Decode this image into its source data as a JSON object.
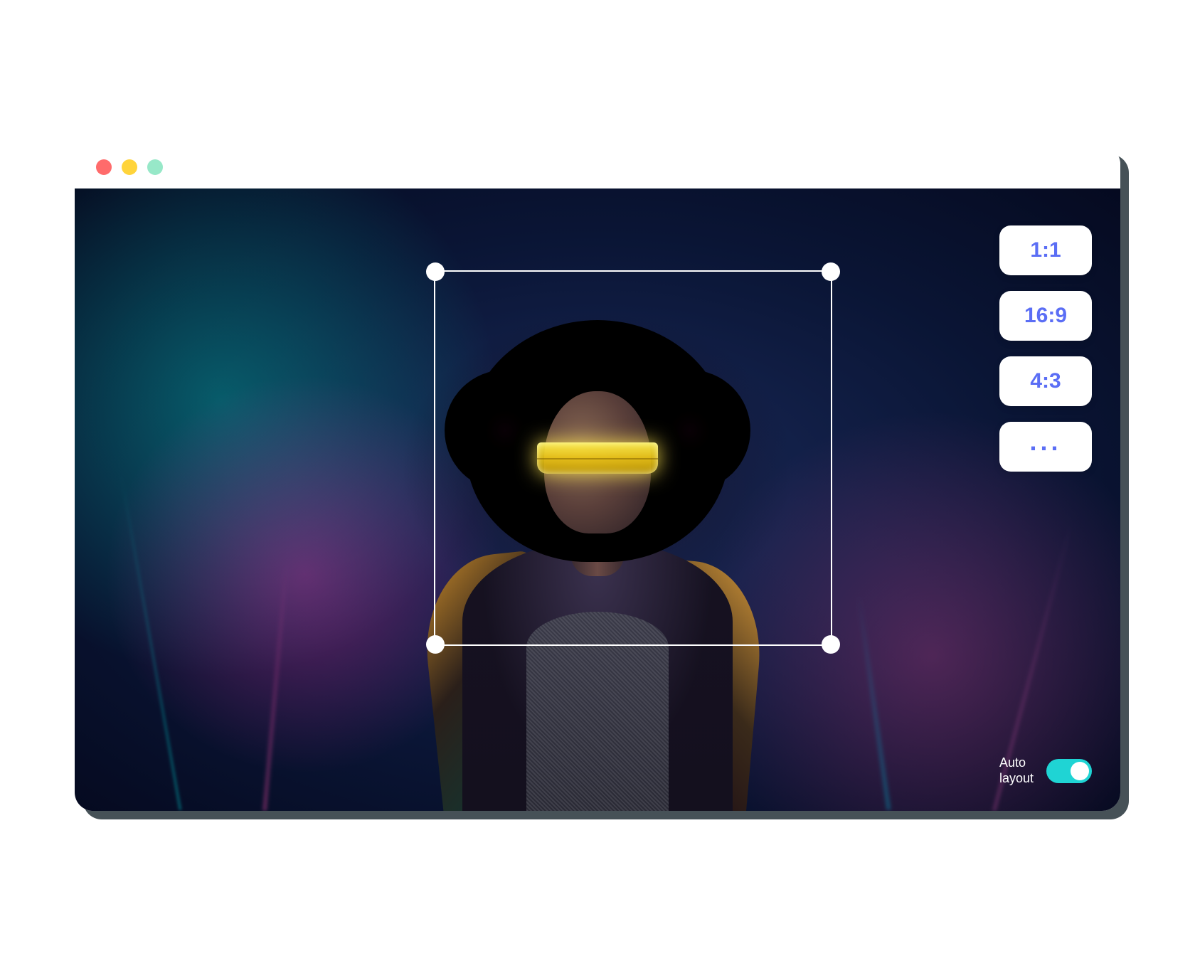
{
  "window": {
    "traffic_dots": {
      "close": "#ff6b6b",
      "minimize": "#ffd43b",
      "zoom": "#97e8c8"
    }
  },
  "ratios": {
    "items": [
      {
        "label": "1:1"
      },
      {
        "label": "16:9"
      },
      {
        "label": "4:3"
      }
    ],
    "more_label": "..."
  },
  "auto_layout": {
    "label": "Auto\nlayout",
    "enabled": true,
    "toggle_color": "#1fd4d4"
  },
  "crop": {
    "handle_color": "#ffffff",
    "border_color": "#ffffff"
  },
  "accent_color": "#5b6ef5"
}
